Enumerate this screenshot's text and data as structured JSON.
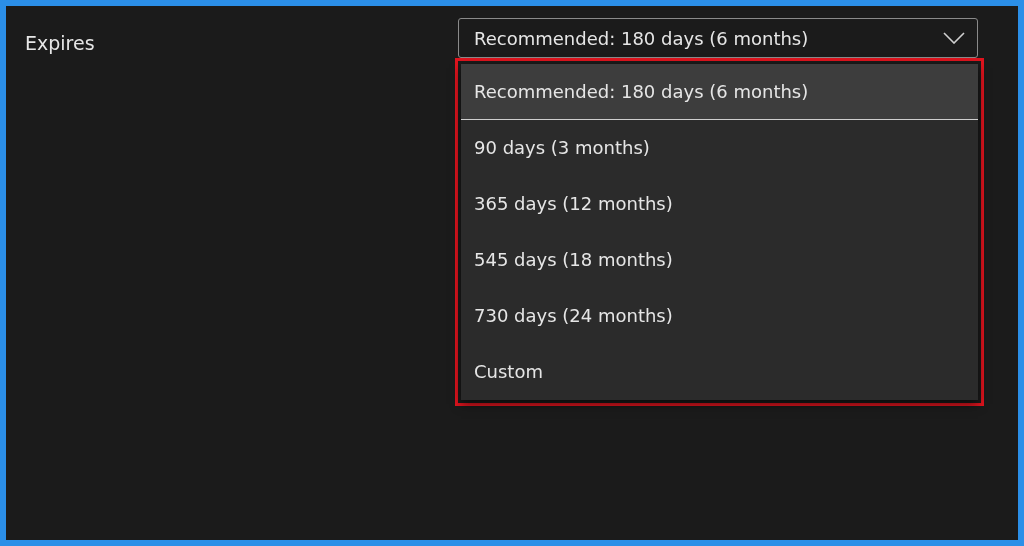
{
  "field": {
    "label": "Expires",
    "value": "Recommended: 180 days (6 months)",
    "expanded": true
  },
  "menu": {
    "highlighted": true,
    "options": [
      {
        "label": "Recommended: 180 days (6 months)",
        "selected": true
      },
      {
        "label": "90 days (3 months)",
        "selected": false
      },
      {
        "label": "365 days (12 months)",
        "selected": false
      },
      {
        "label": "545 days (18 months)",
        "selected": false
      },
      {
        "label": "730 days (24 months)",
        "selected": false
      },
      {
        "label": "Custom",
        "selected": false
      }
    ]
  }
}
